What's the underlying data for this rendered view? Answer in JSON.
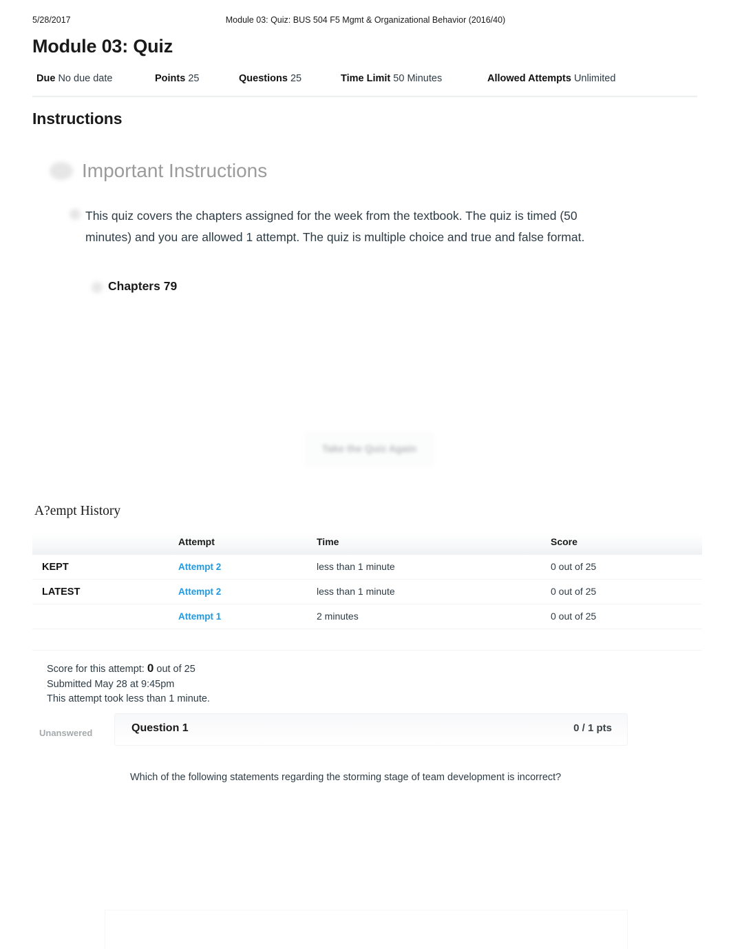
{
  "print_header": {
    "date": "5/28/2017",
    "title": "Module 03: Quiz: BUS 504 F5  Mgmt & Organizational Behavior (2016/40)"
  },
  "page_title": "Module 03: Quiz",
  "meta": [
    {
      "key": "Due",
      "value": "No due date"
    },
    {
      "key": "Points",
      "value": "25"
    },
    {
      "key": "Questions",
      "value": "25"
    },
    {
      "key": "Time Limit",
      "value": "50 Minutes"
    },
    {
      "key": "Allowed Attempts",
      "value": "Unlimited"
    }
  ],
  "instructions": {
    "heading": "Instructions",
    "important_title": "Important Instructions",
    "paragraph": "This quiz covers the chapters assigned for the week from the textbook. The quiz is timed (50 minutes) and you are allowed 1 attempt. The quiz is multiple choice and true and false format.",
    "chapters": "Chapters 79"
  },
  "retake": {
    "label": "Take the Quiz Again"
  },
  "attempt_history": {
    "title": "A?empt History",
    "columns": {
      "label": "",
      "attempt": "Attempt",
      "time": "Time",
      "score": "Score"
    },
    "rows": [
      {
        "label": "KEPT",
        "attempt": "Attempt 2",
        "time": "less than 1 minute",
        "score": "0 out of 25"
      },
      {
        "label": "LATEST",
        "attempt": "Attempt 2",
        "time": "less than 1 minute",
        "score": "0 out of 25"
      },
      {
        "label": "",
        "attempt": "Attempt 1",
        "time": "2 minutes",
        "score": "0 out of 25"
      }
    ]
  },
  "attempt_summary": {
    "score_prefix": "Score for this attempt:",
    "score_value": "0",
    "score_suffix": "out of 25",
    "submitted": "Submitted May 28 at 9:45pm",
    "duration": "This attempt took less than 1 minute."
  },
  "question": {
    "status": "Unanswered",
    "label": "Question 1",
    "points": "0 / 1 pts",
    "text": "Which of the following statements regarding the storming stage of team development is incorrect?"
  },
  "colors": {
    "link_blue": "#1f9ae0",
    "muted_gray": "#9b9b9b",
    "body_text": "#2d3b45"
  }
}
